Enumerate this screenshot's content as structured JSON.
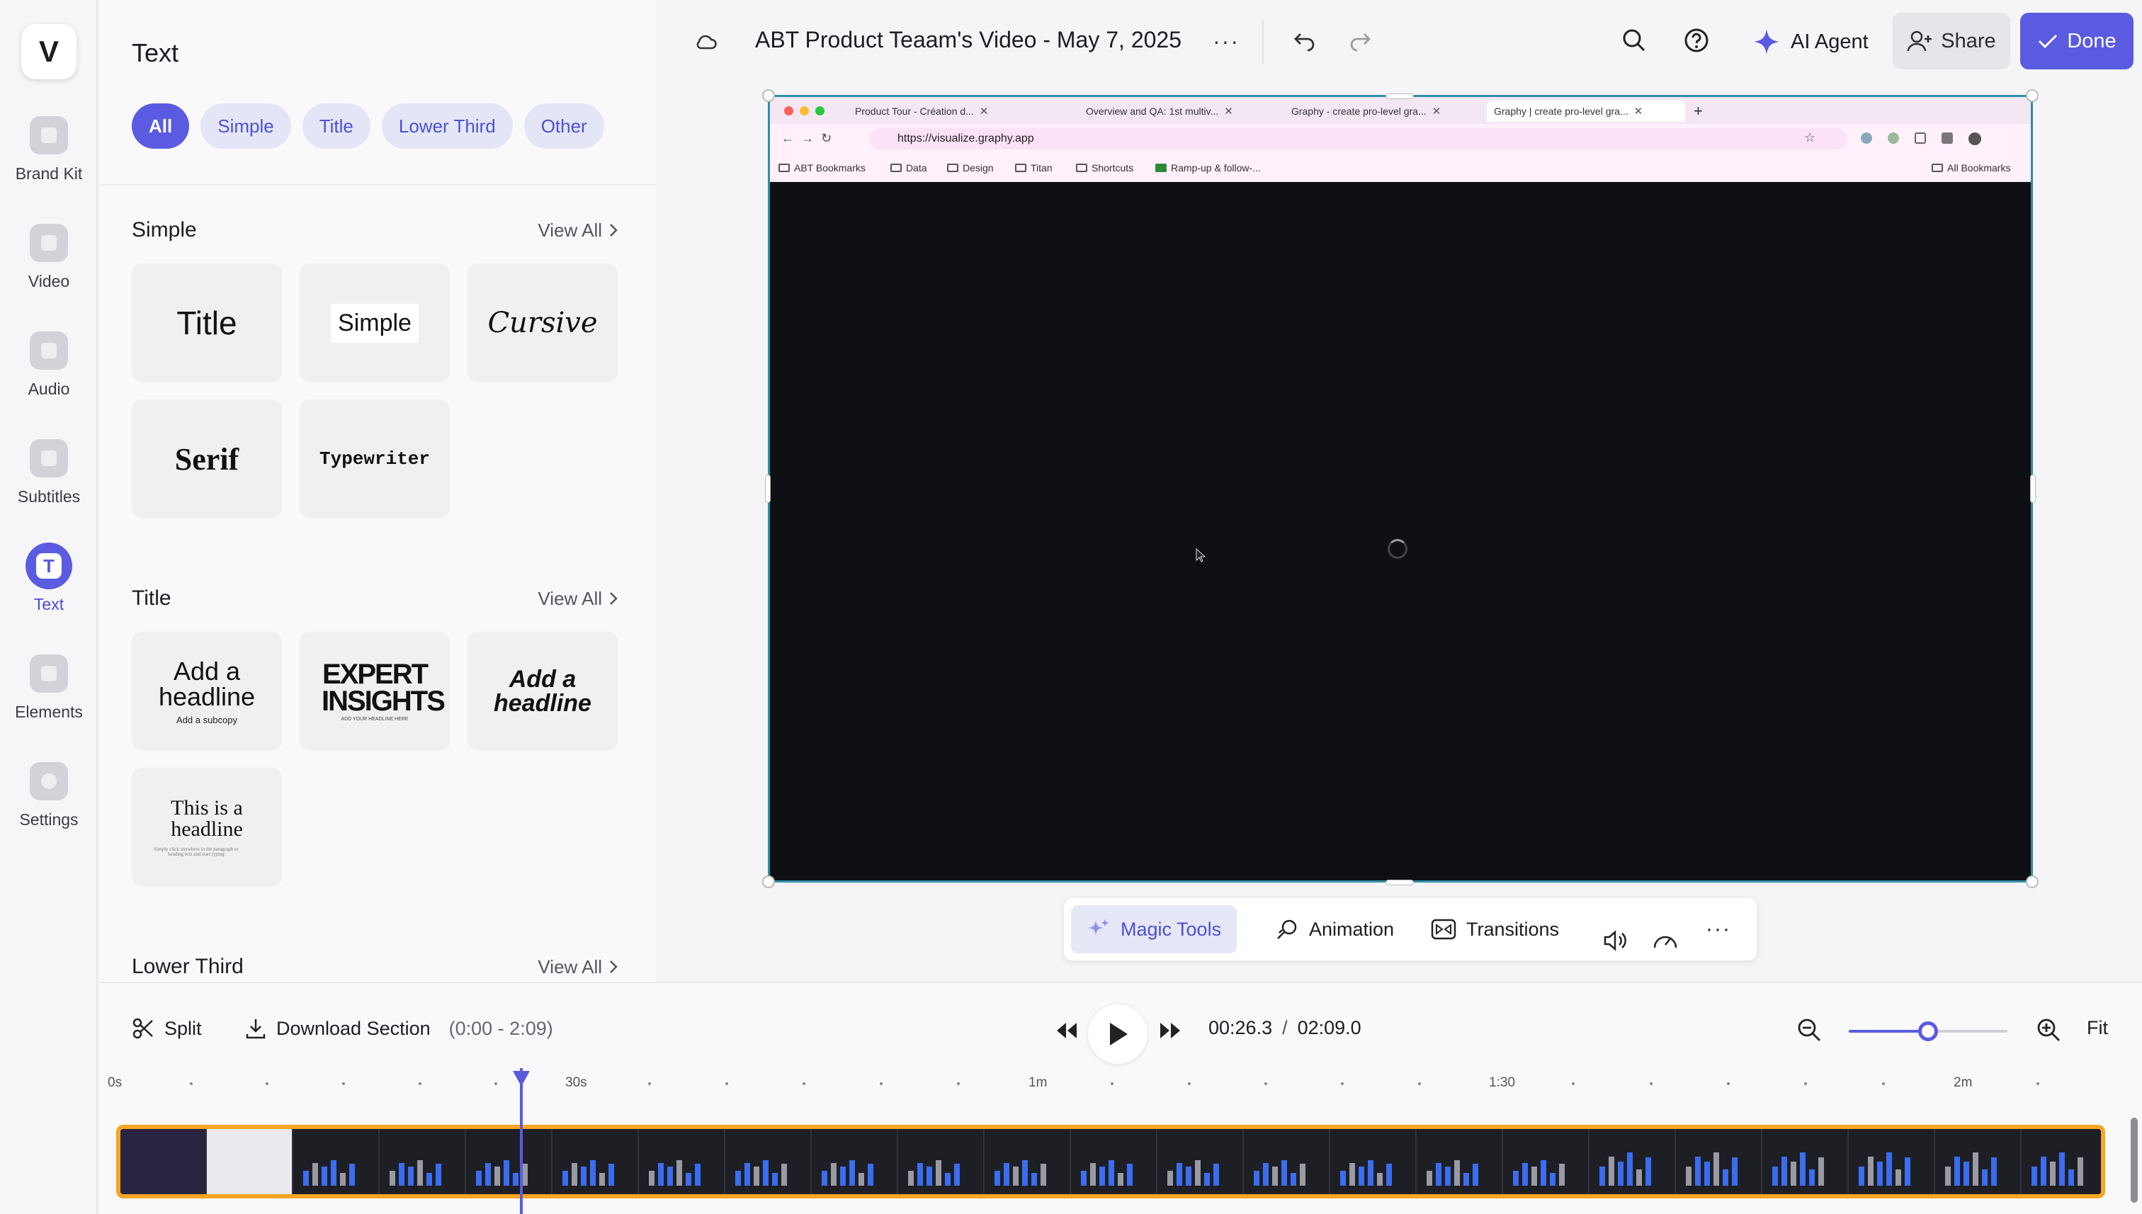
{
  "rail": {
    "logo": "V",
    "items": [
      {
        "label": "Brand Kit",
        "icon": "brand-kit-icon"
      },
      {
        "label": "Video",
        "icon": "video-camera-icon"
      },
      {
        "label": "Audio",
        "icon": "music-note-icon"
      },
      {
        "label": "Subtitles",
        "icon": "subtitles-icon"
      },
      {
        "label": "Text",
        "icon": "text-icon",
        "glyph": "T"
      },
      {
        "label": "Elements",
        "icon": "elements-icon"
      },
      {
        "label": "Settings",
        "icon": "settings-icon"
      }
    ]
  },
  "panel": {
    "title": "Text",
    "chips": [
      "All",
      "Simple",
      "Title",
      "Lower Third",
      "Other"
    ],
    "view_all": "View All",
    "sections": {
      "simple": {
        "title": "Simple",
        "cards": [
          "Title",
          "Simple",
          "Cursive",
          "Serif",
          "Typewriter"
        ]
      },
      "title": {
        "title": "Title",
        "card1": {
          "headline": "Add a headline",
          "sub": "Add a subcopy"
        },
        "card2": {
          "headline": "EXPERT INSIGHTS",
          "sub": "ADD YOUR HEADLINE HERE"
        },
        "card3": {
          "headline": "Add a headline"
        },
        "card4": {
          "headline": "This is a headline",
          "sub": "Simply click anywhere in the paragraph or heading text and start typing"
        }
      },
      "lower_third": {
        "title": "Lower Third"
      }
    }
  },
  "topbar": {
    "project_title": "ABT Product Teaam's Video - May 7, 2025",
    "more": "···",
    "ai_agent": "AI Agent",
    "share": "Share",
    "done": "Done"
  },
  "browser": {
    "tabs": [
      "Product Tour - Création d...",
      "Overview and QA: 1st multiv...",
      "Graphy - create pro-level gra...",
      "Graphy | create pro-level gra..."
    ],
    "url": "https://visualize.graphy.app",
    "bookmarks": [
      "ABT Bookmarks",
      "Data",
      "Design",
      "Titan",
      "Shortcuts",
      "Ramp-up & follow-..."
    ],
    "all_bookmarks": "All Bookmarks"
  },
  "cliptools": {
    "magic": "Magic Tools",
    "animation": "Animation",
    "transitions": "Transitions"
  },
  "timeline": {
    "split": "Split",
    "download": "Download Section",
    "range": "(0:00 - 2:09)",
    "current_time": "00:26.3",
    "separator": "/",
    "total_time": "02:09.0",
    "fit": "Fit",
    "zoom_level": 0.5,
    "ruler_labels": [
      "0s",
      "30s",
      "1m",
      "1:30",
      "2m"
    ]
  },
  "colors": {
    "accent": "#5a5be0",
    "clip_border": "#f5a623",
    "frame_border": "#2d8fa7"
  }
}
